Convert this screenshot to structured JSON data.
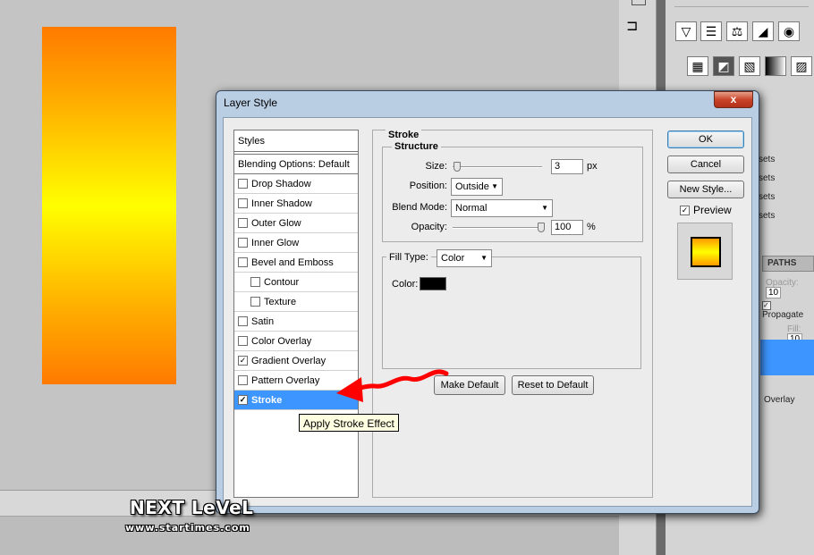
{
  "dialog": {
    "title": "Layer Style",
    "close_label": "x",
    "ok_label": "OK",
    "cancel_label": "Cancel",
    "new_style_label": "New Style...",
    "preview_label": "Preview",
    "preview_checked": true
  },
  "styles_list": {
    "header": "Styles",
    "blending": "Blending Options: Default",
    "items": [
      {
        "label": "Drop Shadow",
        "checked": false,
        "indent": false
      },
      {
        "label": "Inner Shadow",
        "checked": false,
        "indent": false
      },
      {
        "label": "Outer Glow",
        "checked": false,
        "indent": false
      },
      {
        "label": "Inner Glow",
        "checked": false,
        "indent": false
      },
      {
        "label": "Bevel and Emboss",
        "checked": false,
        "indent": false
      },
      {
        "label": "Contour",
        "checked": false,
        "indent": true
      },
      {
        "label": "Texture",
        "checked": false,
        "indent": true
      },
      {
        "label": "Satin",
        "checked": false,
        "indent": false
      },
      {
        "label": "Color Overlay",
        "checked": false,
        "indent": false
      },
      {
        "label": "Gradient Overlay",
        "checked": true,
        "indent": false
      },
      {
        "label": "Pattern Overlay",
        "checked": false,
        "indent": false
      },
      {
        "label": "Stroke",
        "checked": true,
        "indent": false,
        "selected": true
      }
    ]
  },
  "stroke": {
    "title": "Stroke",
    "structure_title": "Structure",
    "size_label": "Size:",
    "size_value": "3",
    "size_unit": "px",
    "position_label": "Position:",
    "position_value": "Outside",
    "blend_label": "Blend Mode:",
    "blend_value": "Normal",
    "opacity_label": "Opacity:",
    "opacity_value": "100",
    "opacity_unit": "%",
    "fill_type_label": "Fill Type:",
    "fill_type_value": "Color",
    "color_label": "Color:",
    "color_value": "#000000",
    "make_default_label": "Make Default",
    "reset_default_label": "Reset to Default"
  },
  "tooltip": "Apply Stroke Effect",
  "right_panel": {
    "items": [
      "sets",
      "sets",
      "sets",
      "sets"
    ],
    "paths_tab": "PATHS",
    "opacity_label": "Opacity:",
    "opacity_value": "10",
    "propagate_label": "Propagate",
    "fill_label": "Fill:",
    "fill_value": "10",
    "overlay_label": "Overlay"
  },
  "watermark": {
    "title": "NEXT LeVeL",
    "url": "www.startimes.com"
  },
  "colors": {
    "selection_blue": "#3d95ff",
    "gradient_orange": "#ff7a00",
    "gradient_yellow": "#ffff00",
    "arrow_red": "#ff0000"
  }
}
